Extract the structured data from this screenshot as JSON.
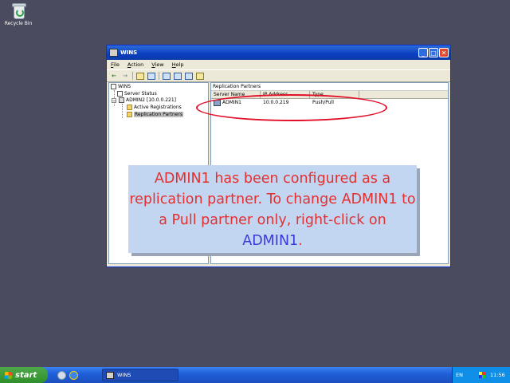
{
  "desktop": {
    "recycle_bin_label": "Recycle Bin"
  },
  "window": {
    "title": "WINS",
    "menu": [
      "File",
      "Action",
      "View",
      "Help"
    ]
  },
  "tree": {
    "root": "WINS",
    "server_status": "Server Status",
    "server": "ADMIN2 [10.0.0.221]",
    "active_registrations": "Active Registrations",
    "replication_partners": "Replication Partners"
  },
  "detail": {
    "title": "Replication Partners",
    "columns": [
      "Server Name",
      "IP Address",
      "Type"
    ],
    "rows": [
      {
        "name": "ADMIN1",
        "ip": "10.0.0.219",
        "type": "Push/Pull"
      }
    ]
  },
  "callout": {
    "text_before": "ADMIN1 has been configured as a replication partner. To change ADMIN1 to a Pull partner only, right-click on ",
    "highlight": "ADMIN1",
    "text_after": "."
  },
  "taskbar": {
    "start_label": "start",
    "task_label": "WINS",
    "language": "EN",
    "clock": "11:56"
  },
  "colors": {
    "annotation": "#e3102a",
    "callout_text": "#e4302f",
    "callout_highlight": "#3a3ad8",
    "callout_bg": "#c2d6f2"
  }
}
